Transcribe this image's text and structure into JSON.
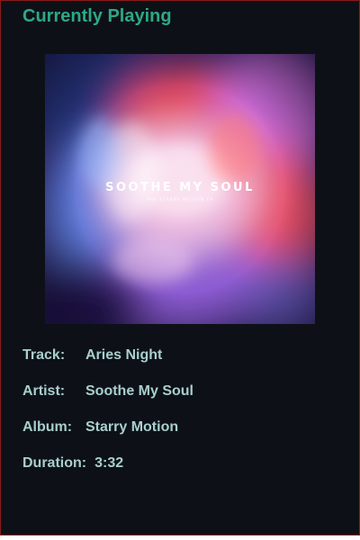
{
  "header": {
    "title": "Currently Playing"
  },
  "album_art": {
    "artist_text": "SOOTHE MY SOUL",
    "subtitle_text": "THE STARRY MOTION EP"
  },
  "track_info": {
    "track_label": "Track:",
    "track_value": "Aries Night",
    "artist_label": "Artist:",
    "artist_value": "Soothe My Soul",
    "album_label": "Album:",
    "album_value": "Starry Motion",
    "duration_label": "Duration:",
    "duration_value": "3:32"
  },
  "colors": {
    "background": "#0d1117",
    "title": "#2ea884",
    "text": "#a9cfcc",
    "border": "#8b1a1a"
  }
}
